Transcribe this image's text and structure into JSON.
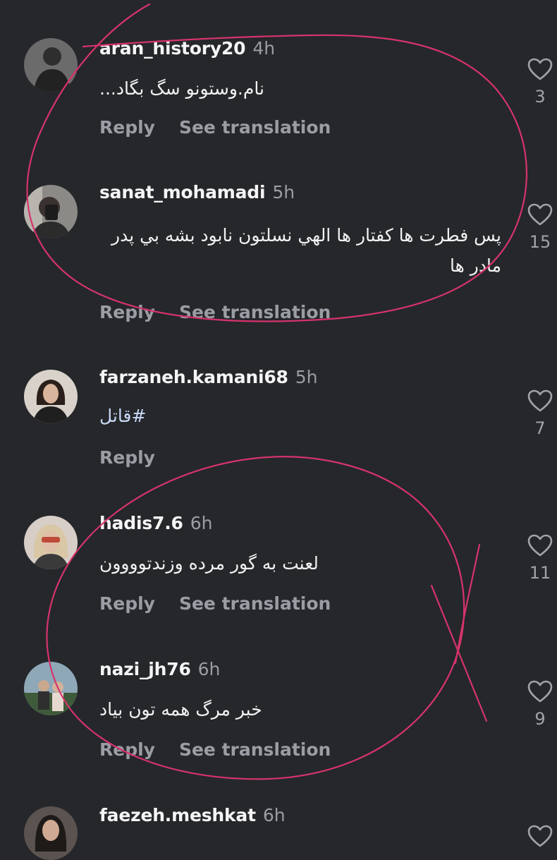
{
  "comments": [
    {
      "username": "aran_history20",
      "time": "4h",
      "text": "نام.وستونو سگ بگاد...",
      "reply": "Reply",
      "translate": "See translation",
      "likes": "3"
    },
    {
      "username": "sanat_mohamadi",
      "time": "5h",
      "text": "پس فطرت ها کفتار ها الهي نسلتون نابود بشه بي پدر مادر ها",
      "reply": "Reply",
      "translate": "See translation",
      "likes": "15"
    },
    {
      "username": "farzaneh.kamani68",
      "time": "5h",
      "text": "#قاتل",
      "reply": "Reply",
      "likes": "7"
    },
    {
      "username": "hadis7.6",
      "time": "6h",
      "text": "لعنت به گور مرده وزندتوووون",
      "reply": "Reply",
      "translate": "See translation",
      "likes": "11"
    },
    {
      "username": "nazi_jh76",
      "time": "6h",
      "text": "خبر مرگ همه تون بیاد",
      "reply": "Reply",
      "translate": "See translation",
      "likes": "9"
    },
    {
      "username": "faezeh.meshkat",
      "time": "6h"
    }
  ],
  "icons": {
    "like": "heart-outline-icon"
  },
  "colors": {
    "background": "#25272b",
    "annotation": "#d6336c",
    "muted": "#9a9da3"
  }
}
